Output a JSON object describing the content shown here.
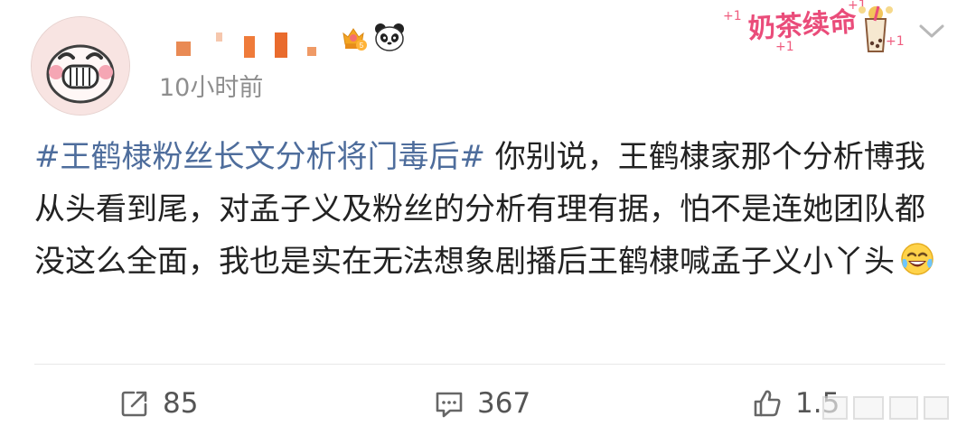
{
  "header": {
    "timestamp": "10小时前",
    "decor_sticker": {
      "text": "奶茶续命",
      "plus_marks": [
        "+1",
        "+1",
        "+1",
        "+1"
      ]
    },
    "icons": {
      "avatar": "cartoon-face-avatar",
      "vip_badge": "crown-level-badge",
      "panda_badge": "panda-badge",
      "menu": "chevron-down-icon"
    }
  },
  "post": {
    "hashtag": "#王鹤棣粉丝长文分析将门毒后#",
    "body_text": " 你别说，王鹤棣家那个分析博我从头看到尾，对孟子义及粉丝的分析有理有据，怕不是连她团队都没这么全面，我也是实在无法想象剧播后王鹤棣喊孟子义小丫头",
    "trailing_emoji": "laughing-tears-emoji"
  },
  "actions": {
    "share": {
      "icon": "share-icon",
      "count": "85"
    },
    "comment": {
      "icon": "comment-icon",
      "count": "367"
    },
    "like": {
      "icon": "thumbs-up-icon",
      "count": "1.5"
    }
  },
  "colors": {
    "hashtag": "#4e6d9c",
    "text": "#222222",
    "meta": "#8e8e8e",
    "sticker_pink": "#ea4c7a"
  }
}
